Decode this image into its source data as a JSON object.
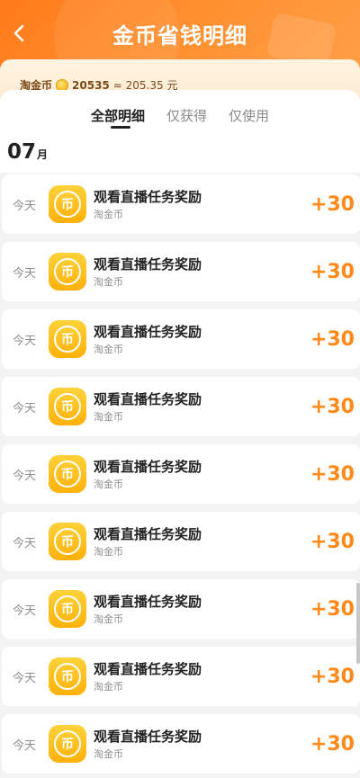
{
  "header": {
    "title": "金币省钱明细"
  },
  "balance": {
    "label": "淘金币",
    "coins": "20535",
    "approx": "≈ 205.35",
    "unit": "元"
  },
  "tabs": [
    {
      "label": "全部明细",
      "active": true
    },
    {
      "label": "仅获得",
      "active": false
    },
    {
      "label": "仅使用",
      "active": false
    }
  ],
  "month": {
    "number": "07",
    "unit": "月"
  },
  "records": [
    {
      "date": "今天",
      "icon_glyph": "币",
      "title": "观看直播任务奖励",
      "source": "淘金币",
      "amount": "+30"
    },
    {
      "date": "今天",
      "icon_glyph": "币",
      "title": "观看直播任务奖励",
      "source": "淘金币",
      "amount": "+30"
    },
    {
      "date": "今天",
      "icon_glyph": "币",
      "title": "观看直播任务奖励",
      "source": "淘金币",
      "amount": "+30"
    },
    {
      "date": "今天",
      "icon_glyph": "币",
      "title": "观看直播任务奖励",
      "source": "淘金币",
      "amount": "+30"
    },
    {
      "date": "今天",
      "icon_glyph": "币",
      "title": "观看直播任务奖励",
      "source": "淘金币",
      "amount": "+30"
    },
    {
      "date": "今天",
      "icon_glyph": "币",
      "title": "观看直播任务奖励",
      "source": "淘金币",
      "amount": "+30"
    },
    {
      "date": "今天",
      "icon_glyph": "币",
      "title": "观看直播任务奖励",
      "source": "淘金币",
      "amount": "+30"
    },
    {
      "date": "今天",
      "icon_glyph": "币",
      "title": "观看直播任务奖励",
      "source": "淘金币",
      "amount": "+30"
    },
    {
      "date": "今天",
      "icon_glyph": "币",
      "title": "观看直播任务奖励",
      "source": "淘金币",
      "amount": "+30"
    }
  ],
  "colors": {
    "accent": "#ff8a1a",
    "header": "#ff7a1a",
    "coin": "#ffc21a"
  },
  "icons": {
    "back": "chevron-left-icon",
    "coin": "coin-icon"
  }
}
